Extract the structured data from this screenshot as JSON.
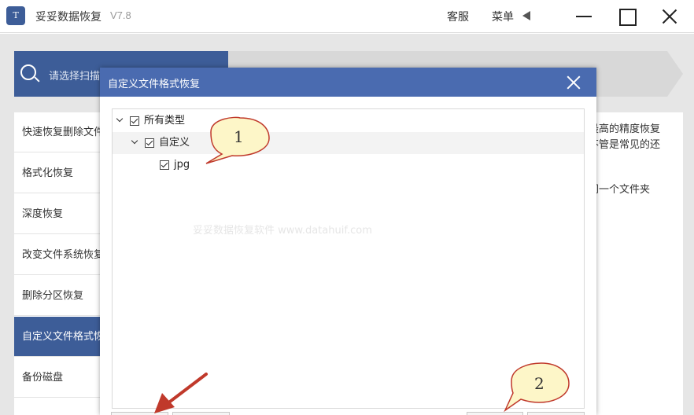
{
  "app": {
    "logo_text": "T",
    "title": "妥妥数据恢复",
    "version": "V7.8",
    "support_label": "客服",
    "menu_label": "菜单"
  },
  "steps": {
    "active_label": "请选择扫描"
  },
  "sidebar": {
    "items": [
      {
        "label": "快速恢复删除文件"
      },
      {
        "label": "格式化恢复"
      },
      {
        "label": "深度恢复"
      },
      {
        "label": "改变文件系统恢复"
      },
      {
        "label": "删除分区恢复"
      },
      {
        "label": "自定义文件格式恢复"
      },
      {
        "label": "备份磁盘"
      }
    ]
  },
  "content": {
    "line1": "最高的精度恢复",
    "line2": "不管是常见的还",
    "line3": "同一个文件夹"
  },
  "dialog": {
    "title": "自定义文件格式恢复",
    "tree": {
      "root": "所有类型",
      "custom": "自定义",
      "leaf": "jpg"
    },
    "watermark": "妥妥数据恢复软件 www.datahuif.com"
  },
  "callouts": {
    "c1": "1",
    "c2": "2",
    "arrow_color": "#c0392b",
    "bubble_fill": "#fdf6c8"
  },
  "colors": {
    "brand_blue": "#3d5d98",
    "dialog_header": "#4a6bb0"
  }
}
